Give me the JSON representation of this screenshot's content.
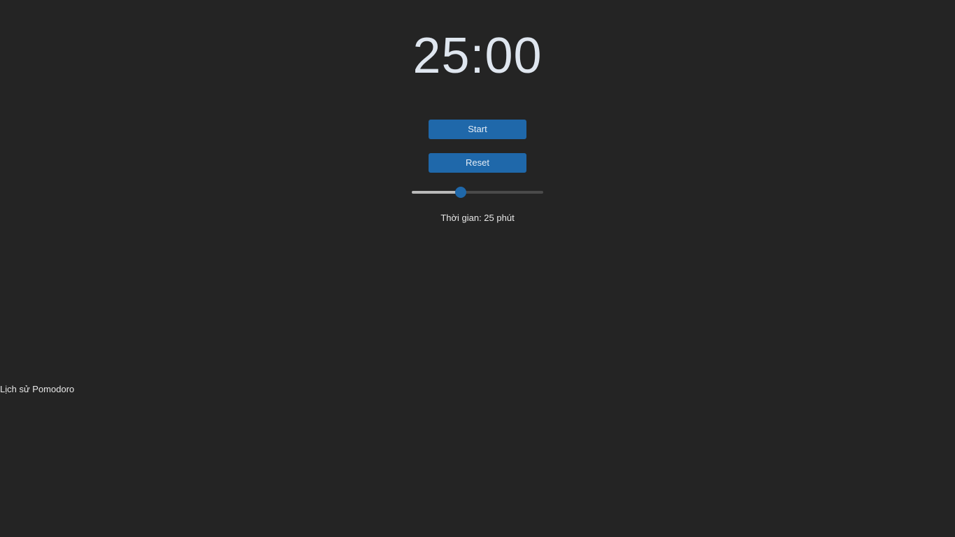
{
  "timer": {
    "display": "25:00"
  },
  "controls": {
    "start_label": "Start",
    "reset_label": "Reset"
  },
  "duration": {
    "label": "Thời gian: 25 phút",
    "slider_fraction": 0.37
  },
  "history": {
    "title": "Lịch sử Pomodoro"
  },
  "colors": {
    "background": "#242424",
    "accent": "#1f68aa",
    "timer_text": "#dfe6ef"
  }
}
